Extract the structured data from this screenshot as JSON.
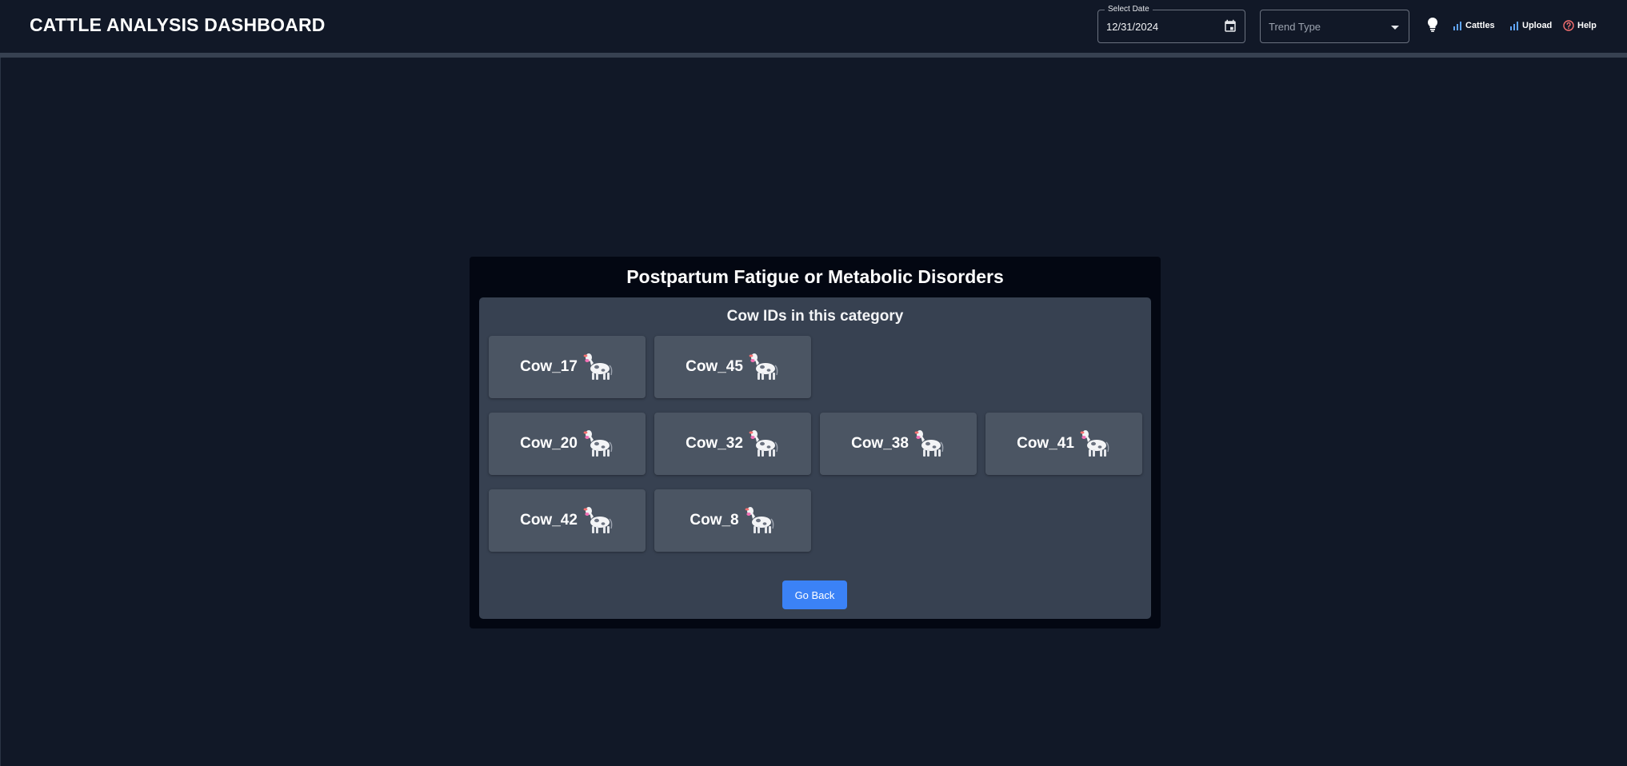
{
  "header": {
    "title": "CATTLE ANALYSIS DASHBOARD",
    "date_label": "Select Date",
    "date_value": "12/31/2024",
    "trend_placeholder": "Trend Type",
    "nav": {
      "cattles": "Cattles",
      "upload": "Upload",
      "help": "Help"
    }
  },
  "modal": {
    "title": "Postpartum Fatigue or Metabolic Disorders",
    "subtitle": "Cow IDs in this category",
    "cows": [
      "Cow_17",
      "Cow_45",
      "Cow_20",
      "Cow_32",
      "Cow_38",
      "Cow_41",
      "Cow_42",
      "Cow_8"
    ],
    "go_back": "Go Back"
  },
  "colors": {
    "background": "#111827",
    "modal": "#030712",
    "panel": "#374151",
    "card": "#4b5563",
    "accent": "#3b82f6",
    "help": "#f87171"
  },
  "icons": {
    "date": "calendar-icon",
    "trend": "chevron-down-icon",
    "bulb": "lightbulb-icon",
    "cattles": "bar-chart-icon",
    "upload": "bar-chart-icon",
    "help": "help-circle-icon",
    "cow": "cow-icon"
  }
}
